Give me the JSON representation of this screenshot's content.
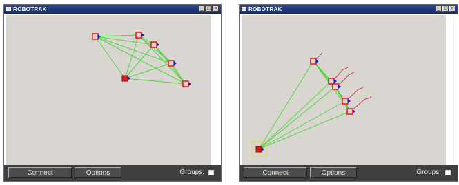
{
  "windows": [
    {
      "title": "ROBOTRAK",
      "controls": [
        "_",
        "□",
        "×"
      ],
      "connect_label": "Connect",
      "options_label": "Options",
      "groups_label": "Groups:",
      "groups_checked": false
    },
    {
      "title": "ROBOTRAK",
      "controls": [
        "_",
        "□",
        "×"
      ],
      "connect_label": "Connect",
      "options_label": "Options",
      "groups_label": "Groups:",
      "groups_checked": false
    }
  ],
  "colors": {
    "canvas_bg": "#d9d6d2",
    "link_line": "#52d43f",
    "robot_red": "#e01818",
    "robot_blue": "#1a1ad8",
    "trail": "#c83a3a",
    "selection": "#e8d53a"
  },
  "icons": [
    "robot-marker-icon",
    "robot-leader-icon"
  ]
}
